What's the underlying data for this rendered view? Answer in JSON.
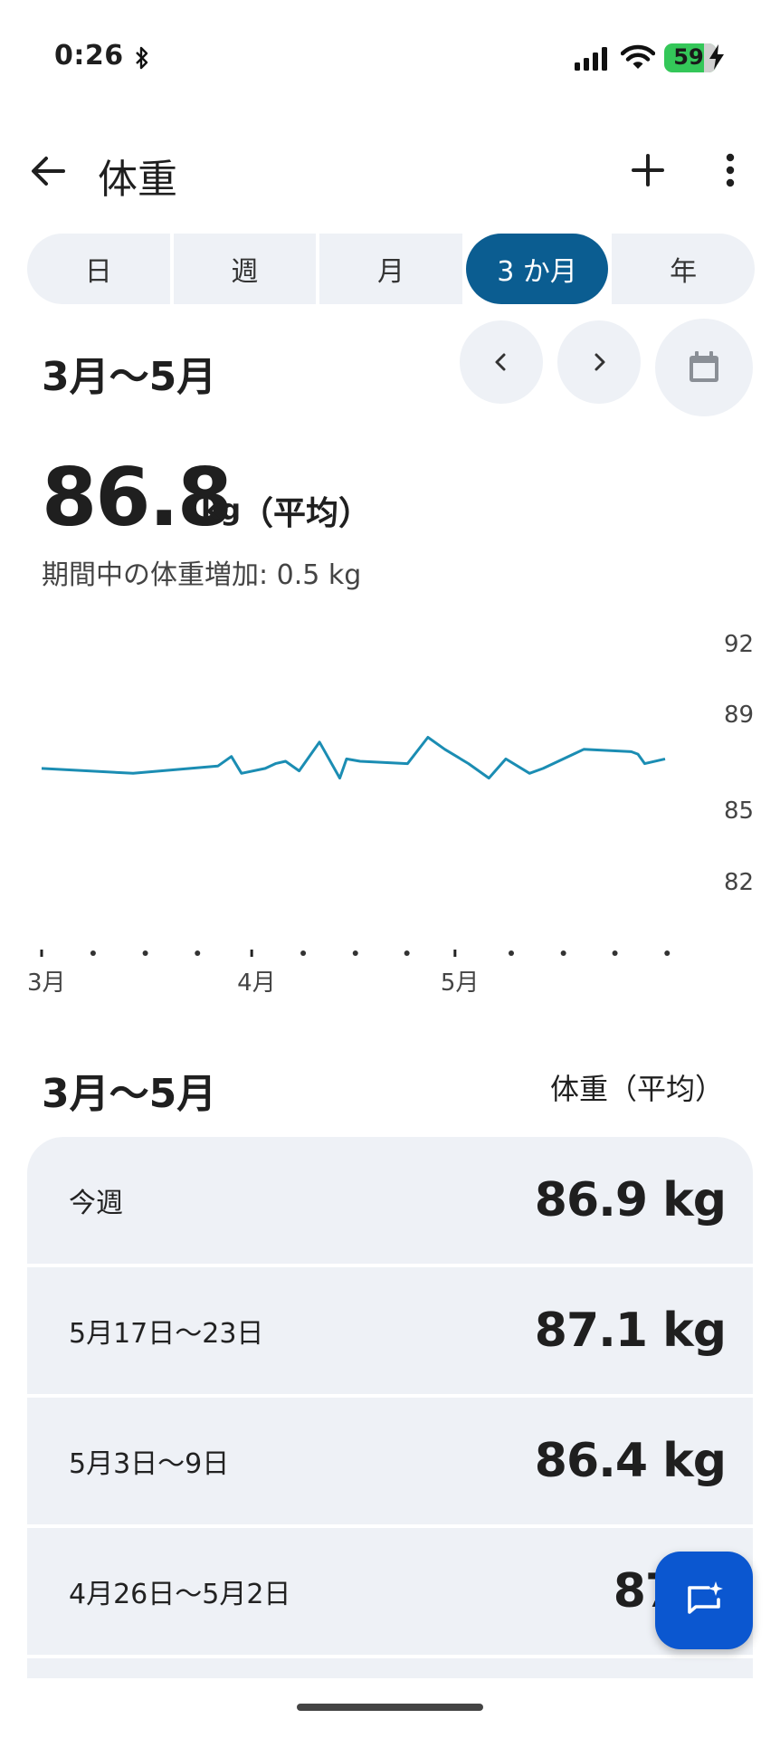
{
  "status_bar": {
    "time": "0:26",
    "battery": "59"
  },
  "app_bar": {
    "title": "体重"
  },
  "segments": [
    {
      "label": "日",
      "active": false
    },
    {
      "label": "週",
      "active": false
    },
    {
      "label": "月",
      "active": false
    },
    {
      "label": "3 か月",
      "active": true
    },
    {
      "label": "年",
      "active": false
    }
  ],
  "period": {
    "label": "3月〜5月"
  },
  "summary": {
    "value": "86.8",
    "unit": "kg",
    "note": "（平均）",
    "gain_text": "期間中の体重増加: 0.5 kg"
  },
  "chart_data": {
    "type": "line",
    "x_unit": "days since Mar 1",
    "y_ticks": [
      82,
      85,
      89,
      92
    ],
    "ylim": [
      82,
      92
    ],
    "xlim": [
      0,
      92
    ],
    "x_tick_labels": [
      {
        "label": "3月",
        "x": 0
      },
      {
        "label": "4月",
        "x": 31
      },
      {
        "label": "5月",
        "x": 61
      }
    ],
    "x_dots": [
      7.6,
      15.3,
      23,
      38.6,
      46.3,
      53.9,
      69.3,
      77,
      84.6,
      92.3
    ],
    "series": [
      {
        "name": "",
        "color": "#1b8db3",
        "x": [
          0,
          13.5,
          26,
          28,
          29.5,
          33,
          34.5,
          36,
          38,
          41,
          44,
          45,
          47,
          54,
          57,
          59.5,
          63,
          66,
          68.5,
          72,
          74,
          80,
          87,
          88,
          89,
          92
        ],
        "y": [
          86.7,
          86.5,
          86.8,
          87.2,
          86.5,
          86.7,
          86.9,
          87.0,
          86.6,
          87.8,
          86.3,
          87.1,
          87.0,
          86.9,
          88.0,
          87.5,
          86.9,
          86.3,
          87.1,
          86.5,
          86.7,
          87.5,
          87.4,
          87.3,
          86.9,
          87.1
        ]
      }
    ]
  },
  "list": {
    "range_label": "3月〜5月",
    "column_label": "体重（平均）",
    "rows": [
      {
        "label": "今週",
        "value": "86.9 kg"
      },
      {
        "label": "5月17日〜23日",
        "value": "87.1 kg"
      },
      {
        "label": "5月3日〜9日",
        "value": "86.4 kg"
      },
      {
        "label": "4月26日〜5月2日",
        "value": "87.1"
      }
    ]
  },
  "icons": {
    "back": "arrow-left-icon",
    "add": "plus-icon",
    "more": "more-vert-icon",
    "prev": "chevron-left-icon",
    "next": "chevron-right-icon",
    "calendar": "calendar-icon",
    "fab": "ai-chat-icon"
  },
  "colors": {
    "accent": "#0b5d91",
    "line": "#1b8db3",
    "fab": "#0b57d0"
  }
}
